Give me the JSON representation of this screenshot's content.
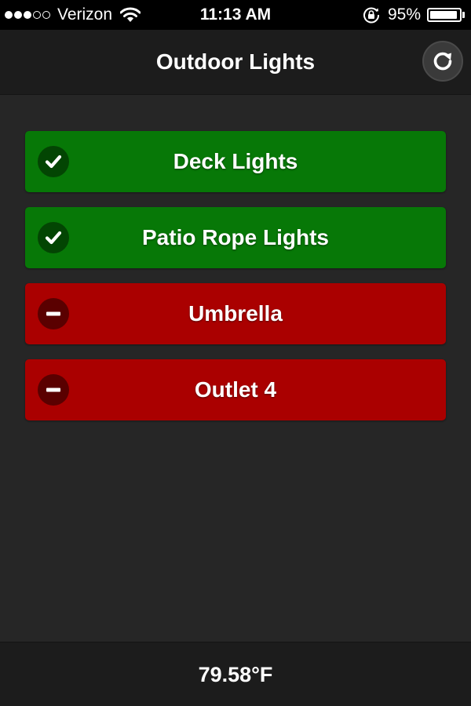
{
  "status_bar": {
    "signal": {
      "bars_on": 3,
      "bars_total": 5
    },
    "carrier": "Verizon",
    "wifi_icon": "wifi-icon",
    "time": "11:13 AM",
    "rotation_lock_icon": "rotation-lock-icon",
    "battery_percent": "95%",
    "battery_level": 0.95
  },
  "header": {
    "title": "Outdoor Lights",
    "refresh_icon": "refresh-icon"
  },
  "lights": [
    {
      "label": "Deck Lights",
      "state": "on",
      "icon": "check-icon",
      "color": "#077807"
    },
    {
      "label": "Patio Rope Lights",
      "state": "on",
      "icon": "check-icon",
      "color": "#077807"
    },
    {
      "label": "Umbrella",
      "state": "off",
      "icon": "minus-icon",
      "color": "#aa0000"
    },
    {
      "label": "Outlet 4",
      "state": "off",
      "icon": "minus-icon",
      "color": "#aa0000"
    }
  ],
  "footer": {
    "temperature": "79.58°F"
  }
}
